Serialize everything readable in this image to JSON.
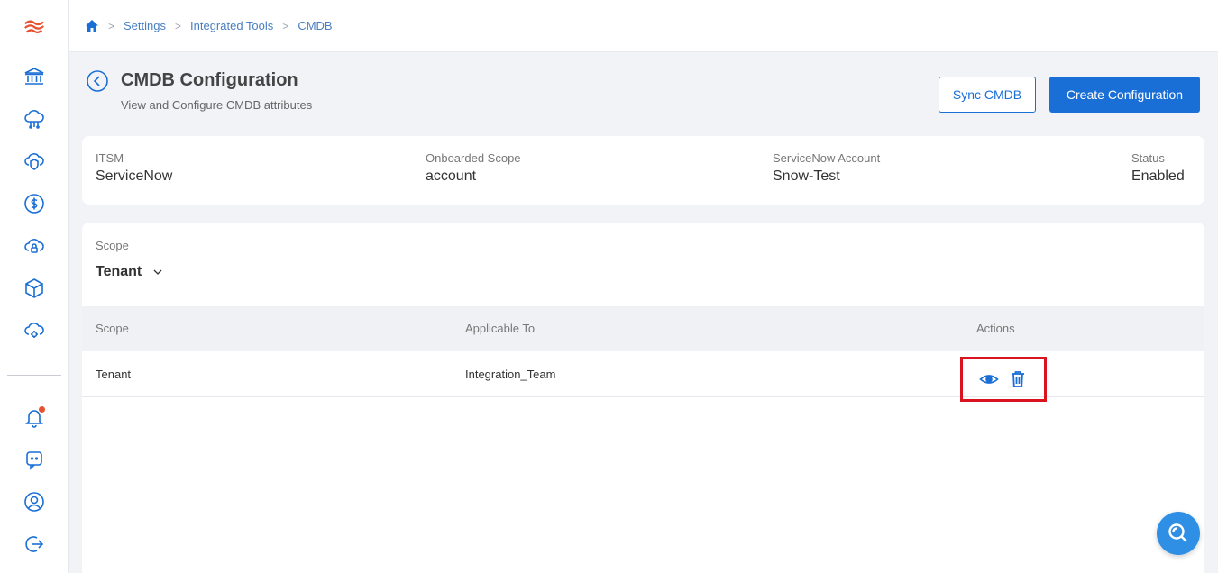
{
  "breadcrumb": {
    "home_icon": "home-icon",
    "items": [
      "Settings",
      "Integrated Tools",
      "CMDB"
    ]
  },
  "header": {
    "title": "CMDB Configuration",
    "subtitle": "View and Configure CMDB attributes",
    "sync_label": "Sync CMDB",
    "create_label": "Create Configuration"
  },
  "info": {
    "itsm_label": "ITSM",
    "itsm_value": "ServiceNow",
    "scope_label": "Onboarded Scope",
    "scope_value": "account",
    "account_label": "ServiceNow Account",
    "account_value": "Snow-Test",
    "status_label": "Status",
    "status_value": "Enabled"
  },
  "scope": {
    "label": "Scope",
    "selected": "Tenant"
  },
  "table": {
    "columns": [
      "Scope",
      "Applicable To",
      "Actions"
    ],
    "rows": [
      {
        "scope": "Tenant",
        "applicable_to": "Integration_Team"
      }
    ]
  },
  "colors": {
    "accent": "#1a6fd6",
    "highlight": "#d9141e",
    "notification": "#e8502f",
    "brand": "#e8502f"
  },
  "sidebar_icons": [
    "logo-icon",
    "bank-icon",
    "cloud-network-icon",
    "cloud-shield-icon",
    "dollar-icon",
    "cloud-lock-icon",
    "cube-icon",
    "cloud-gear-icon",
    "bell-icon",
    "chat-icon",
    "user-icon",
    "logout-icon"
  ]
}
